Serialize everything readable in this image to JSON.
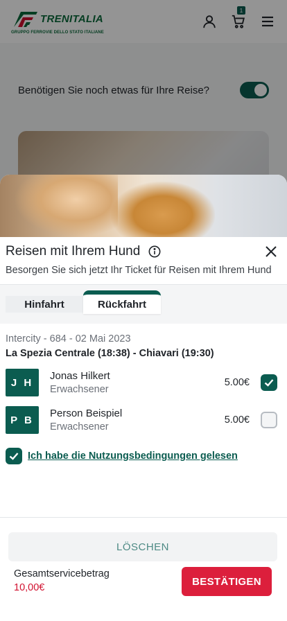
{
  "header": {
    "logo_text": "TRENITALIA",
    "logo_subtext": "GRUPPO FERROVIE DELLO STATO ITALIANE",
    "cart_count": "1",
    "icons": [
      "user-icon",
      "cart-icon",
      "menu-icon"
    ]
  },
  "background": {
    "question": "Benötigen Sie noch etwas für Ihre Reise?",
    "toggle_on": true
  },
  "sheet": {
    "title": "Reisen mit Ihrem Hund",
    "subtitle": "Besorgen Sie sich jetzt Ihr Ticket für Reisen mit Ihrem Hund",
    "tabs": [
      {
        "label": "Hinfahrt",
        "active": false
      },
      {
        "label": "Rückfahrt",
        "active": true
      }
    ],
    "journey": {
      "train": "Intercity - 684 - 02 Mai 2023",
      "route": "La Spezia Centrale (18:38) - Chiavari (19:30)"
    },
    "passengers": [
      {
        "initials": "J H",
        "name": "Jonas Hilkert",
        "type": "Erwachsener",
        "price": "5.00€",
        "checked": true
      },
      {
        "initials": "P B",
        "name": "Person Beispiel",
        "type": "Erwachsener",
        "price": "5.00€",
        "checked": false
      }
    ],
    "terms_label": "Ich habe die Nutzungsbedingungen gelesen",
    "delete_label": "LÖSCHEN",
    "total_label": "Gesamtservicebetrag",
    "total_value": "10,00€",
    "confirm_label": "BESTÄTIGEN"
  },
  "colors": {
    "brand_green": "#0b5c50",
    "confirm_red": "#dc1f3c",
    "price_red": "#d1102f"
  }
}
